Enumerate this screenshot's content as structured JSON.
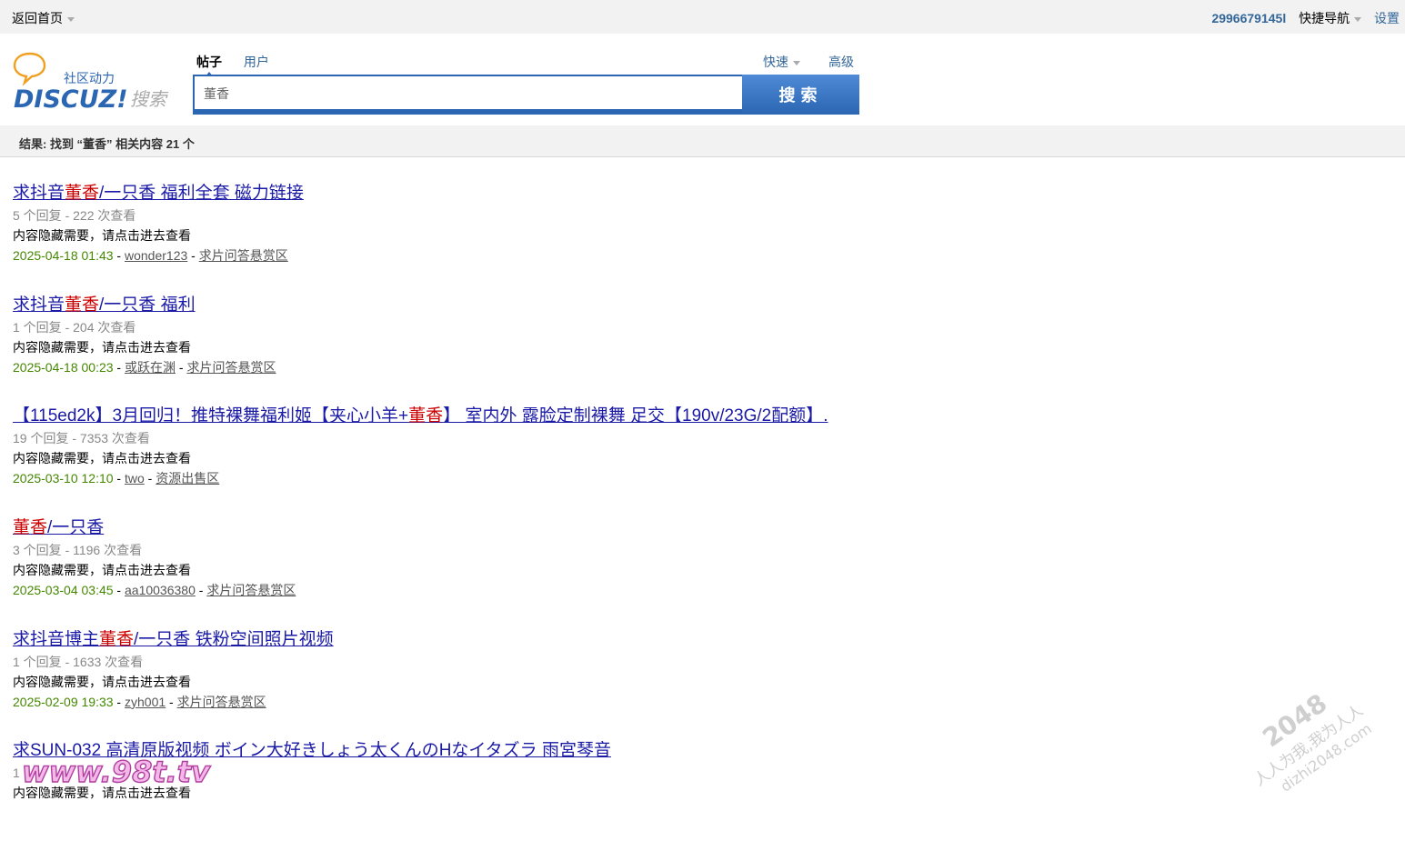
{
  "topbar": {
    "home": "返回首页",
    "uid": "2996679145l",
    "quick_nav": "快捷导航",
    "settings": "设置"
  },
  "logo": {
    "tagline": "社区动力",
    "brand": "DISCUZ!",
    "search_word": "搜索"
  },
  "search": {
    "tab_posts": "帖子",
    "tab_users": "用户",
    "fast": "快速",
    "advanced": "高级",
    "query": "董香",
    "button": "搜索"
  },
  "result_summary": "结果: 找到 “董香” 相关内容 21 个",
  "results": [
    {
      "title_parts": [
        {
          "text": "求抖音",
          "hl": false
        },
        {
          "text": "董香",
          "hl": true
        },
        {
          "text": "/一只香 福利全套 磁力链接",
          "hl": false
        }
      ],
      "meta": "5 个回复 - 222 次查看",
      "desc": "内容隐藏需要，请点击进去查看",
      "date": "2025-04-18 01:43",
      "author": "wonder123",
      "forum": "求片问答悬赏区"
    },
    {
      "title_parts": [
        {
          "text": "求抖音",
          "hl": false
        },
        {
          "text": "董香",
          "hl": true
        },
        {
          "text": "/一只香 福利",
          "hl": false
        }
      ],
      "meta": "1 个回复 - 204 次查看",
      "desc": "内容隐藏需要，请点击进去查看",
      "date": "2025-04-18 00:23",
      "author": "或跃在渊",
      "forum": "求片问答悬赏区"
    },
    {
      "title_parts": [
        {
          "text": "【115ed2k】3月回归！推特裸舞福利姬【夹心小羊+",
          "hl": false
        },
        {
          "text": "董香",
          "hl": true
        },
        {
          "text": "】 室内外 露脸定制裸舞 足交【190v/23G/2配额】.",
          "hl": false
        }
      ],
      "meta": "19 个回复 - 7353 次查看",
      "desc": "内容隐藏需要，请点击进去查看",
      "date": "2025-03-10 12:10",
      "author": "two",
      "forum": "资源出售区"
    },
    {
      "title_parts": [
        {
          "text": "董香",
          "hl": true
        },
        {
          "text": "/一只香",
          "hl": false
        }
      ],
      "meta": "3 个回复 - 1196 次查看",
      "desc": "内容隐藏需要，请点击进去查看",
      "date": "2025-03-04 03:45",
      "author": "aa10036380",
      "forum": "求片问答悬赏区"
    },
    {
      "title_parts": [
        {
          "text": "求抖音博主",
          "hl": false
        },
        {
          "text": "董香",
          "hl": true
        },
        {
          "text": "/一只香 铁粉空间照片视频",
          "hl": false
        }
      ],
      "meta": "1 个回复 - 1633 次查看",
      "desc": "内容隐藏需要，请点击进去查看",
      "date": "2025-02-09 19:33",
      "author": "zyh001",
      "forum": "求片问答悬赏区"
    },
    {
      "title_parts": [
        {
          "text": "求SUN-032 高清原版视频 ボイン大好きしょう太くんのHなイタズラ 雨宮琴音",
          "hl": false
        }
      ],
      "meta": "1",
      "desc": "内容隐藏需要，请点击进去查看",
      "date": "",
      "author": "",
      "forum": ""
    }
  ],
  "watermarks": {
    "site98": "www.98t.tv",
    "site2048_num": "2048",
    "site2048_slogan": "人人为我,我为人人",
    "site2048_url": "dizhi2048.com"
  },
  "colors": {
    "link": "#1a1aa6",
    "highlight": "#cc0000",
    "date": "#448800",
    "accent_blue": "#2b66b3"
  }
}
